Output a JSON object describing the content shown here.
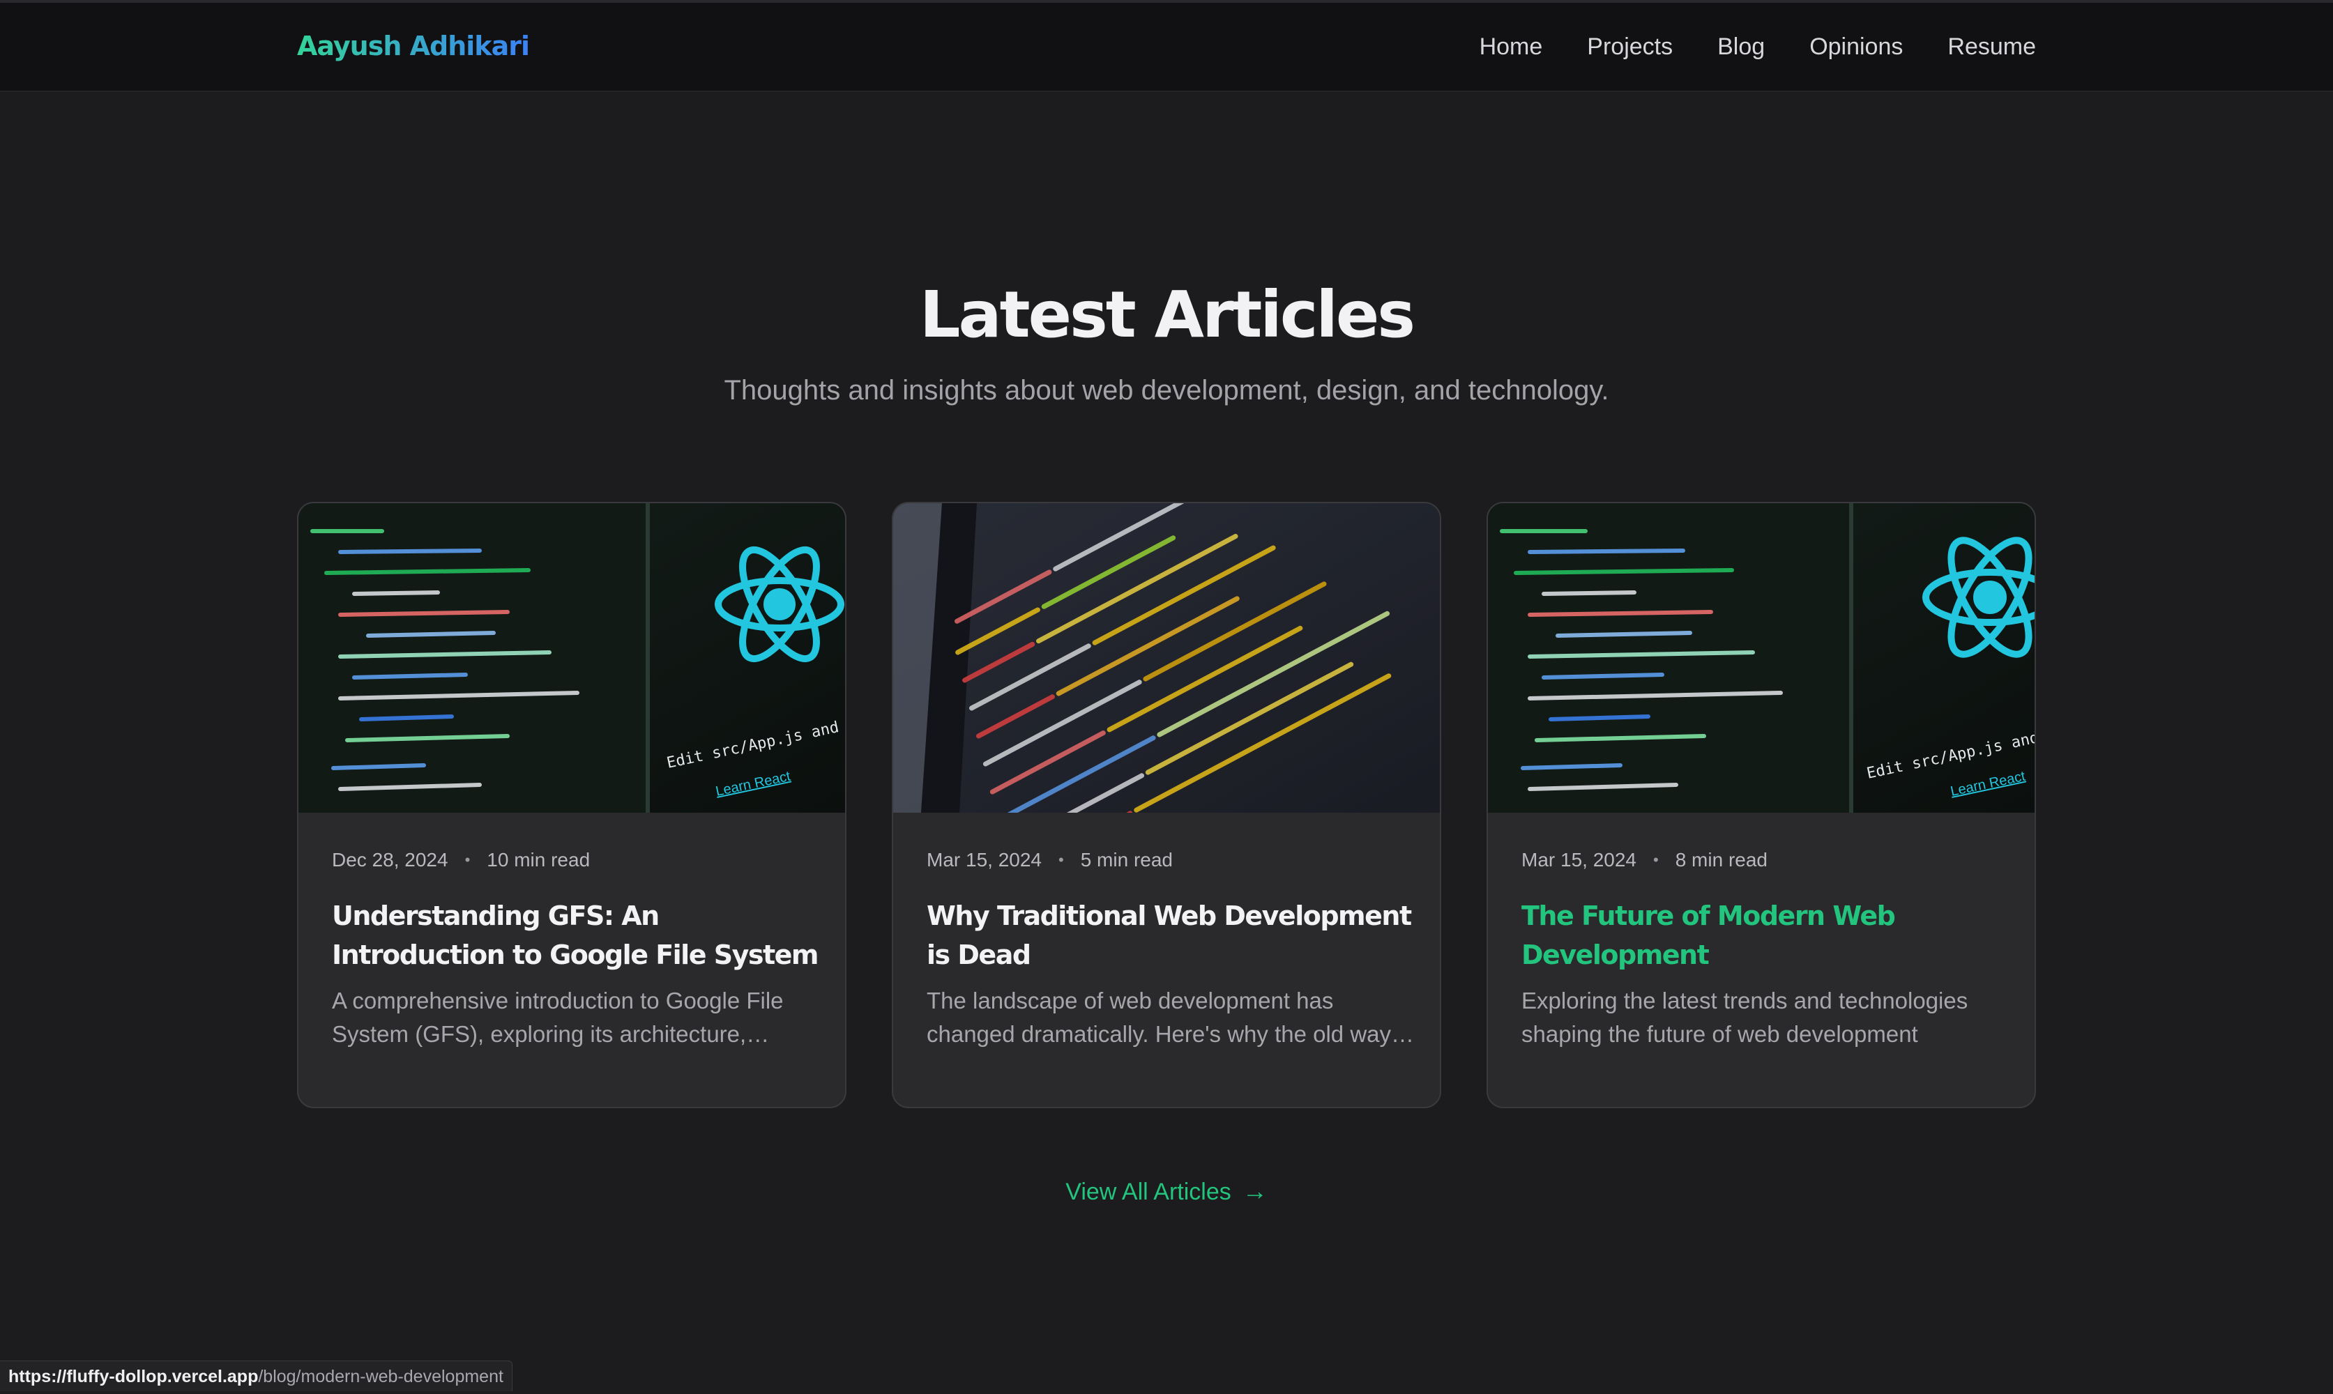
{
  "header": {
    "brand": "Aayush Adhikari",
    "nav": [
      "Home",
      "Projects",
      "Blog",
      "Opinions",
      "Resume"
    ]
  },
  "section": {
    "title": "Latest Articles",
    "subtitle": "Thoughts and insights about web development, design, and technology."
  },
  "articles": [
    {
      "date": "Dec 28, 2024",
      "read_time": "10 min read",
      "title": "Understanding GFS: An Introduction to Google File System",
      "description": "A comprehensive introduction to Google File System (GFS), exploring its architecture, design principles, and real-world applications.",
      "thumbnail": "react-code-editor",
      "thumb_text": "Edit src/App.js and save to reload.",
      "thumb_link": "Learn React",
      "highlighted": false
    },
    {
      "date": "Mar 15, 2024",
      "read_time": "5 min read",
      "title": "Why Traditional Web Development is Dead",
      "description": "The landscape of web development has changed dramatically. Here's why the old ways no longer work.",
      "thumbnail": "php-code-screen",
      "highlighted": false
    },
    {
      "date": "Mar 15, 2024",
      "read_time": "8 min read",
      "title": "The Future of Modern Web Development",
      "description": "Exploring the latest trends and technologies shaping the future of web development",
      "thumbnail": "react-code-editor",
      "thumb_text": "Edit src/App.js and save",
      "thumb_link": "Learn React",
      "highlighted": true
    }
  ],
  "view_all": {
    "label": "View All Articles",
    "arrow": "→"
  },
  "status_bar": {
    "host": "https://fluffy-dollop.vercel.app",
    "path": "/blog/modern-web-development"
  },
  "colors": {
    "accent": "#22c47e",
    "brand_gradient": [
      "#34d399",
      "#3b82f6"
    ],
    "react": "#22c6de",
    "background": "#1c1c1e",
    "card": "#2a2a2d"
  }
}
